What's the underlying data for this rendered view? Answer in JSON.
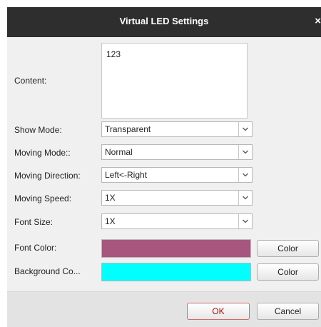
{
  "dialog": {
    "title": "Virtual LED Settings",
    "close_glyph": "×"
  },
  "fields": {
    "content_label": "Content:",
    "content_value": "123",
    "show_mode_label": "Show Mode:",
    "show_mode_value": "Transparent",
    "moving_mode_label": "Moving Mode::",
    "moving_mode_value": "Normal",
    "moving_direction_label": "Moving Direction:",
    "moving_direction_value": "Left<-Right",
    "moving_speed_label": "Moving Speed:",
    "moving_speed_value": "1X",
    "font_size_label": "Font Size:",
    "font_size_value": "1X",
    "font_color_label": "Font Color:",
    "font_color_button": "Color",
    "background_color_label": "Background Co...",
    "background_color_button": "Color"
  },
  "colors": {
    "font_color": "#a7577e",
    "background_color": "#00ffff"
  },
  "footer": {
    "ok_label": "OK",
    "cancel_label": "Cancel"
  }
}
